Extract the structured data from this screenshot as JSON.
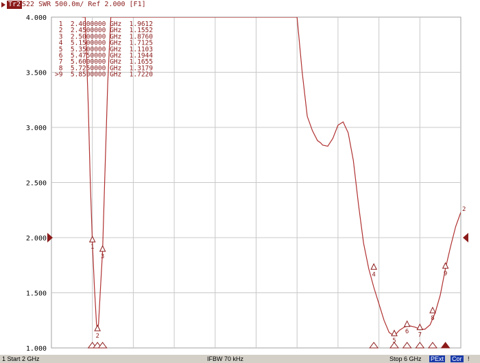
{
  "header": {
    "trace_label": "Tr2",
    "trace_params": "S22  SWR 500.0m/ Ref 2.000 [F1]"
  },
  "status_bar": {
    "channel_start": "1  Start 2 GHz",
    "ifbw": "IFBW 70 kHz",
    "stop": "Stop 6 GHz",
    "pext": "PExt",
    "cor": "Cor",
    "extra": "!"
  },
  "colors": {
    "trace": "#b03030",
    "marker": "#8b1a1a",
    "grid": "#c8c8c8",
    "background": "#ffffff",
    "status_bar": "#d4d0c8",
    "badge": "#1a3aa8"
  },
  "chart_data": {
    "type": "line",
    "title": "",
    "xlabel": "",
    "ylabel": "",
    "xlim": [
      2.0,
      6.0
    ],
    "ylim": [
      1.0,
      4.0
    ],
    "x_unit": "GHz",
    "grid": true,
    "y_ticks": [
      "4.000",
      "3.500",
      "3.000",
      "2.500",
      "2.000",
      "1.500",
      "1.000"
    ],
    "reference_value": 2.0,
    "series": [
      {
        "x": [
          2.3,
          2.33,
          2.36,
          2.38,
          2.4,
          2.42,
          2.44,
          2.45,
          2.46,
          2.48,
          2.5,
          2.52,
          2.55,
          2.58,
          4.4,
          4.45,
          4.5,
          4.55,
          4.6,
          4.63,
          4.65,
          4.7,
          4.75,
          4.8,
          4.85,
          4.9,
          4.95,
          5.0,
          5.05,
          5.1,
          5.15,
          5.2,
          5.25,
          5.3,
          5.35,
          5.4,
          5.45,
          5.5,
          5.55,
          5.6,
          5.65,
          5.7,
          5.75,
          5.8,
          5.85,
          5.9,
          5.95,
          6.0
        ],
        "y": [
          4.0,
          4.0,
          3.2,
          2.5,
          1.96,
          1.55,
          1.22,
          1.16,
          1.22,
          1.55,
          1.88,
          2.5,
          3.4,
          4.0,
          4.0,
          3.5,
          3.1,
          2.97,
          2.88,
          2.86,
          2.84,
          2.83,
          2.9,
          3.02,
          3.05,
          2.95,
          2.7,
          2.3,
          1.95,
          1.72,
          1.55,
          1.4,
          1.25,
          1.14,
          1.11,
          1.16,
          1.19,
          1.2,
          1.19,
          1.17,
          1.17,
          1.21,
          1.32,
          1.48,
          1.72,
          1.92,
          2.1,
          2.23
        ]
      }
    ],
    "markers": [
      {
        "num": "1",
        "active": false,
        "x": 2.4,
        "value": "1.9612",
        "freq": "2.4000000",
        "unit": "GHz"
      },
      {
        "num": "2",
        "active": false,
        "x": 2.45,
        "value": "1.1552",
        "freq": "2.4500000",
        "unit": "GHz"
      },
      {
        "num": "3",
        "active": false,
        "x": 2.5,
        "value": "1.8760",
        "freq": "2.5000000",
        "unit": "GHz"
      },
      {
        "num": "4",
        "active": false,
        "x": 5.15,
        "value": "1.7125",
        "freq": "5.1500000",
        "unit": "GHz"
      },
      {
        "num": "5",
        "active": false,
        "x": 5.35,
        "value": "1.1103",
        "freq": "5.3500000",
        "unit": "GHz"
      },
      {
        "num": "6",
        "active": false,
        "x": 5.475,
        "value": "1.1944",
        "freq": "5.4750000",
        "unit": "GHz"
      },
      {
        "num": "7",
        "active": false,
        "x": 5.6,
        "value": "1.1655",
        "freq": "5.6000000",
        "unit": "GHz"
      },
      {
        "num": "8",
        "active": false,
        "x": 5.725,
        "value": "1.3179",
        "freq": "5.7250000",
        "unit": "GHz"
      },
      {
        "num": "9",
        "active": true,
        "x": 5.85,
        "value": "1.7220",
        "freq": "5.8500000",
        "unit": "GHz"
      }
    ]
  }
}
